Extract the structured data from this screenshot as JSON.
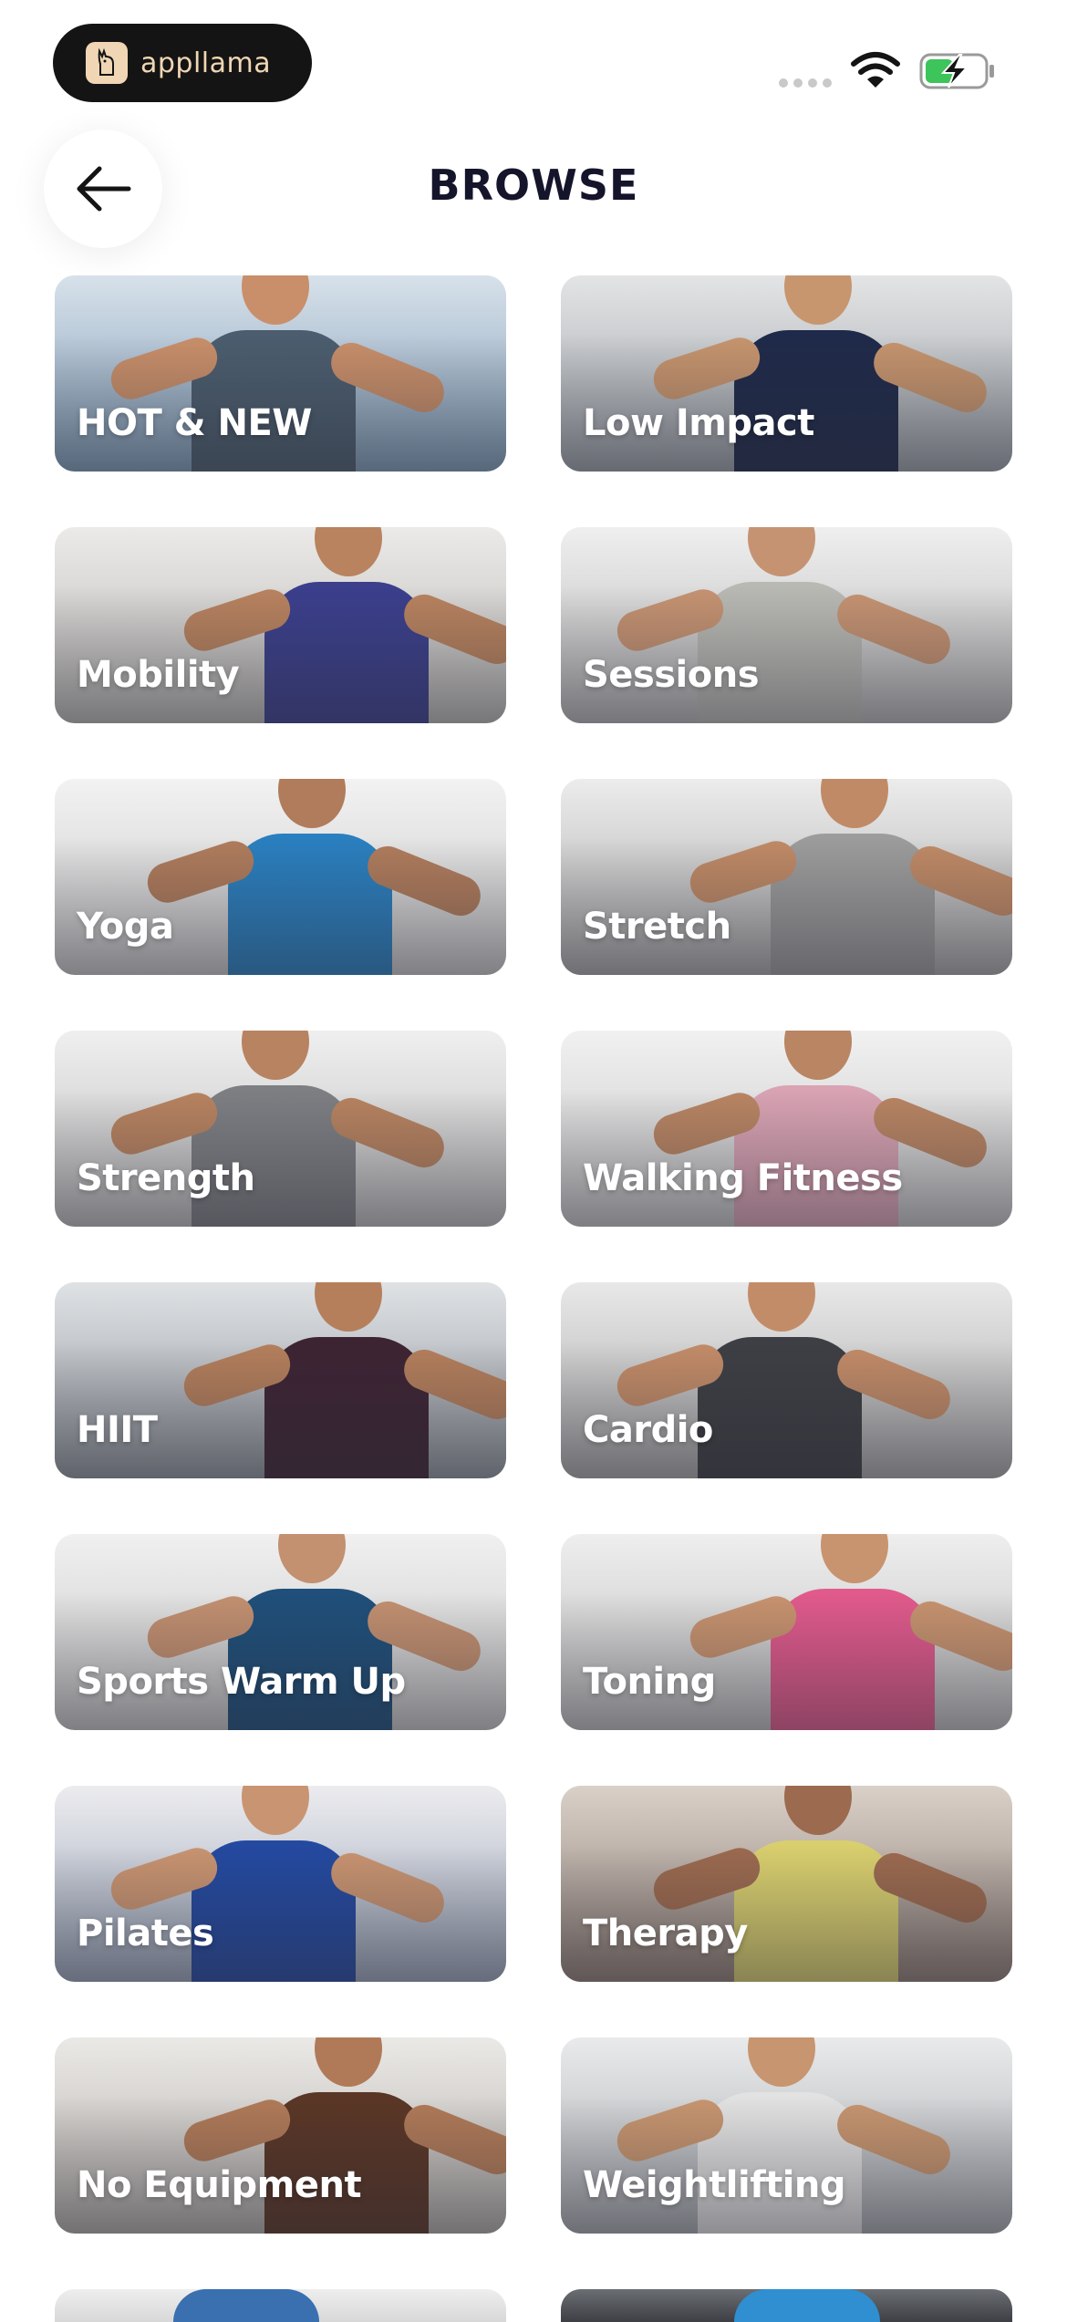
{
  "status_bar": {
    "brand_name": "appllama",
    "icons": [
      "signal-dots-icon",
      "wifi-icon",
      "battery-charging-icon"
    ],
    "battery_color": "#3dc45a"
  },
  "header": {
    "title": "BROWSE",
    "back_icon": "arrow-left-icon"
  },
  "categories": [
    {
      "label": "HOT & NEW",
      "bg": [
        "#7f9cb7",
        "#d7e1ea"
      ],
      "figure": "#4b5d6e",
      "skin": "#c98f6a"
    },
    {
      "label": "Low Impact",
      "bg": [
        "#9aa0a6",
        "#e3e4e5"
      ],
      "figure": "#1f2a4a",
      "skin": "#c7956e"
    },
    {
      "label": "Mobility",
      "bg": [
        "#b8b6b3",
        "#ebeae8"
      ],
      "figure": "#3b3f8c",
      "skin": "#b9835f"
    },
    {
      "label": "Sessions",
      "bg": [
        "#b5b5b5",
        "#efefef"
      ],
      "figure": "#b9b9b4",
      "skin": "#c69372"
    },
    {
      "label": "Yoga",
      "bg": [
        "#c8c8c8",
        "#f2f2f2"
      ],
      "figure": "#2a7fbf",
      "skin": "#b07c5c"
    },
    {
      "label": "Stretch",
      "bg": [
        "#a9a9a9",
        "#ececec"
      ],
      "figure": "#9c9c9c",
      "skin": "#c08a66"
    },
    {
      "label": "Strength",
      "bg": [
        "#bcbcbc",
        "#efefef"
      ],
      "figure": "#7d7f83",
      "skin": "#b88360"
    },
    {
      "label": "Walking Fitness",
      "bg": [
        "#c4c4c4",
        "#f1f1f1"
      ],
      "figure": "#d9a3b3",
      "skin": "#b98563"
    },
    {
      "label": "HIIT",
      "bg": [
        "#8e949a",
        "#dfe2e5"
      ],
      "figure": "#3d2433",
      "skin": "#b57f5c"
    },
    {
      "label": "Cardio",
      "bg": [
        "#a7a7a7",
        "#e8e8e8"
      ],
      "figure": "#3d3f44",
      "skin": "#c38c68"
    },
    {
      "label": "Sports Warm Up",
      "bg": [
        "#c6c6c6",
        "#f0f0f0"
      ],
      "figure": "#1f4f7a",
      "skin": "#c39070"
    },
    {
      "label": "Toning",
      "bg": [
        "#bdbdbd",
        "#eeeeee"
      ],
      "figure": "#e15a8c",
      "skin": "#c8936f"
    },
    {
      "label": "Pilates",
      "bg": [
        "#9aa4b8",
        "#ececef"
      ],
      "figure": "#2449a0",
      "skin": "#c99471"
    },
    {
      "label": "Therapy",
      "bg": [
        "#8d7d74",
        "#d9d0c8"
      ],
      "figure": "#d9cf6e",
      "skin": "#9c6a4f"
    },
    {
      "label": "No Equipment",
      "bg": [
        "#b0aca7",
        "#ebe9e6"
      ],
      "figure": "#5a3626",
      "skin": "#b07a58"
    },
    {
      "label": "Weightlifting",
      "bg": [
        "#a5a9ad",
        "#e9eaeb"
      ],
      "figure": "#e2e2e2",
      "skin": "#c7956f"
    }
  ],
  "partial_cards": [
    {
      "bg": [
        "#d8d8d8",
        "#eeeeee"
      ],
      "figure": "#3a6fb0"
    },
    {
      "bg": [
        "#3d3f44",
        "#6b6e73"
      ],
      "figure": "#2f8fd0"
    }
  ]
}
